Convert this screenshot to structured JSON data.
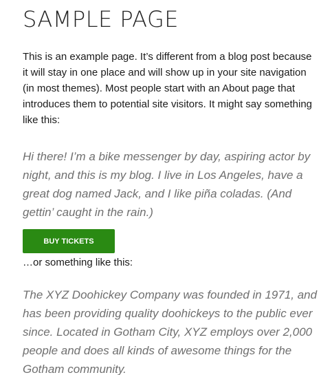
{
  "page": {
    "title": "SAMPLE PAGE",
    "intro": "This is an example page. It’s different from a blog post because it will stay in one place and will show up in your site navigation (in most themes). Most people start with an About page that introduces them to potential site visitors. It might say something like this:",
    "quote_1": "Hi there! I’m a bike messenger by day, aspiring actor by night, and this is my blog. I live in Los Angeles, have a great dog named Jack, and I like piña coladas. (And gettin’ caught in the rain.)",
    "buy_button_label": "BUY TICKETS",
    "or_something": "…or something like this:",
    "quote_2": "The XYZ Doohickey Company was founded in 1971, and has been providing quality doohickeys to the public ever since. Located in Gotham City, XYZ employs over 2,000 people and does all kinds of awesome things for the Gotham community."
  },
  "colors": {
    "button_bg": "#2a8a13",
    "button_text": "#ffffff",
    "quote_text": "#6f6f6f",
    "body_text": "#1a1a1a"
  }
}
